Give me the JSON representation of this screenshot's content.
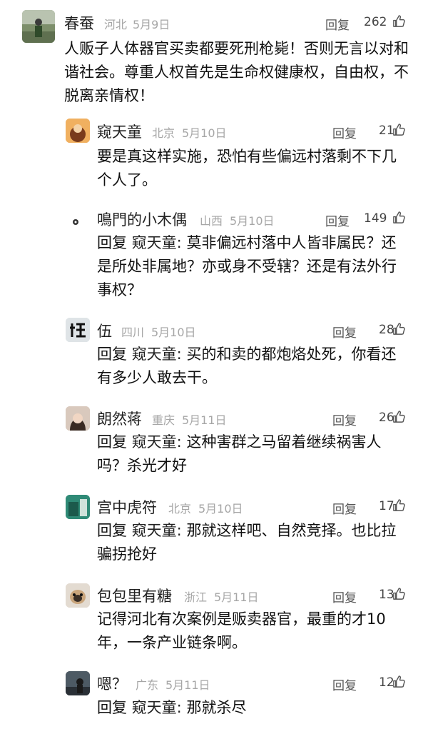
{
  "reply_label": "回复",
  "comments": [
    {
      "username": "春蚕",
      "location": "河北",
      "date": "5月9日",
      "likes": "262",
      "text": "人贩子人体器官买卖都要死刑枪毙！否则无言以对和谐社会。尊重人权首先是生命权健康权，自由权，不脱离亲情权！"
    },
    {
      "username": "窥天童",
      "location": "北京",
      "date": "5月10日",
      "likes": "21",
      "text": "要是真这样实施，恐怕有些偏远村落剩不下几个人了。"
    },
    {
      "username": "鳴門的小木偶",
      "location": "山西",
      "date": "5月10日",
      "likes": "149",
      "reply_to": "窥天童:",
      "text": "莫非偏远村落中人皆非属民？还是所处非属地？亦或身不受辖？还是有法外行事权？"
    },
    {
      "username": "伍",
      "location": "四川",
      "date": "5月10日",
      "likes": "28",
      "reply_to": "窥天童:",
      "text": "买的和卖的都炮烙处死，你看还有多少人敢去干。"
    },
    {
      "username": "朗然蒋",
      "location": "重庆",
      "date": "5月11日",
      "likes": "26",
      "reply_to": "窥天童:",
      "text": "这种害群之马留着继续祸害人吗？杀光才好"
    },
    {
      "username": "宫中虎符",
      "location": "北京",
      "date": "5月10日",
      "likes": "17",
      "reply_to": "窥天童:",
      "text": "那就这样吧、自然竞择。也比拉骗拐抢好"
    },
    {
      "username": "包包里有糖",
      "location": "浙江",
      "date": "5月11日",
      "likes": "13",
      "text": "记得河北有次案例是贩卖器官，最重的才10年，一条产业链条啊。"
    },
    {
      "username": "嗯？",
      "location": "广东",
      "date": "5月11日",
      "likes": "12",
      "reply_to": "窥天童:",
      "text": "那就杀尽"
    }
  ]
}
